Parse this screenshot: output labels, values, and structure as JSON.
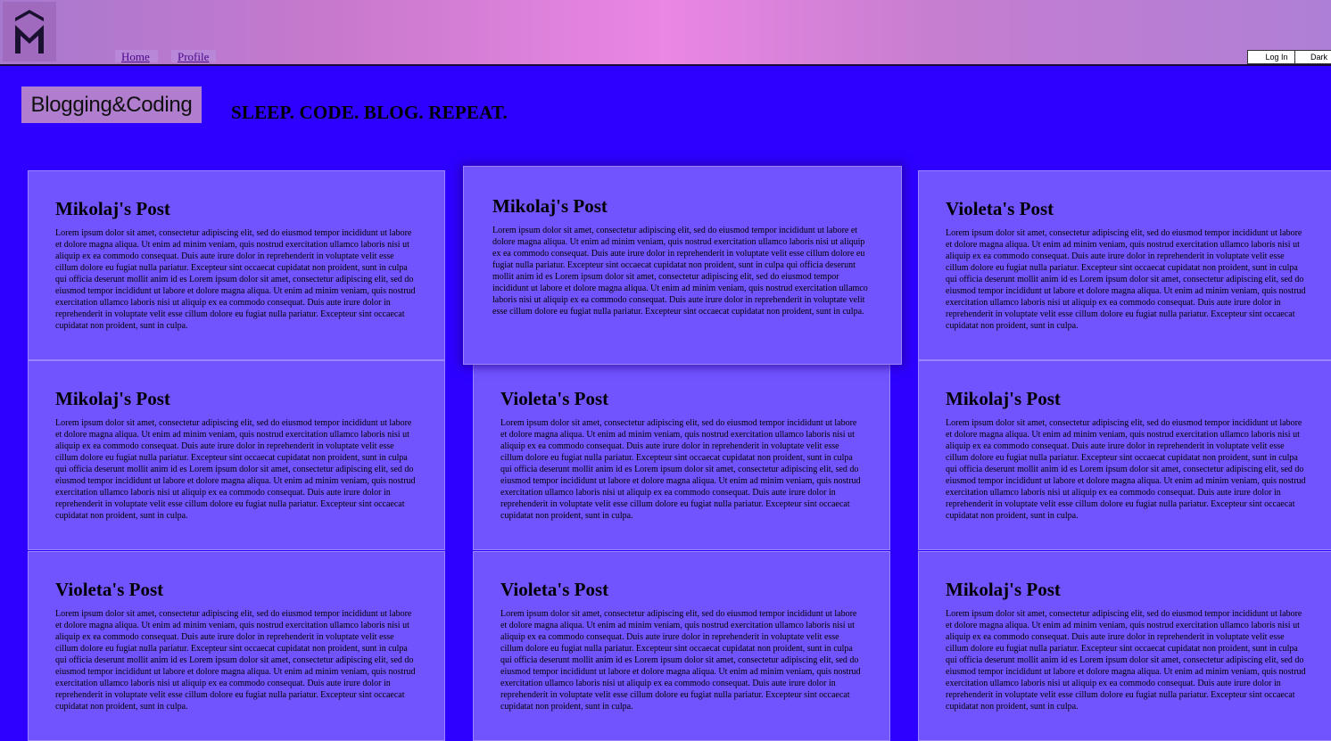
{
  "header": {
    "logo_icon": "M-hexagon-logo-icon",
    "nav": [
      {
        "label": "Home"
      },
      {
        "label": "Profile"
      }
    ],
    "login_label": "Log In",
    "dark_label": "Dark"
  },
  "hero": {
    "brand": "Blogging&Coding",
    "tagline": "SLEEP. CODE. BLOG. REPEAT."
  },
  "posts": [
    {
      "title": "Mikolaj's Post",
      "body": "Lorem ipsum dolor sit amet, consectetur adipiscing elit, sed do eiusmod tempor incididunt ut labore et dolore magna aliqua. Ut enim ad minim veniam, quis nostrud exercitation ullamco laboris nisi ut aliquip ex ea commodo consequat. Duis aute irure dolor in reprehenderit in voluptate velit esse cillum dolore eu fugiat nulla pariatur. Excepteur sint occaecat cupidatat non proident, sunt in culpa qui officia deserunt mollit anim id es Lorem ipsum dolor sit amet, consectetur adipiscing elit, sed do eiusmod tempor incididunt ut labore et dolore magna aliqua. Ut enim ad minim veniam, quis nostrud exercitation ullamco laboris nisi ut aliquip ex ea commodo consequat. Duis aute irure dolor in reprehenderit in voluptate velit esse cillum dolore eu fugiat nulla pariatur. Excepteur sint occaecat cupidatat non proident, sunt in culpa."
    },
    {
      "title": "Mikolaj's Post",
      "body": "Lorem ipsum dolor sit amet, consectetur adipiscing elit, sed do eiusmod tempor incididunt ut labore et dolore magna aliqua. Ut enim ad minim veniam, quis nostrud exercitation ullamco laboris nisi ut aliquip ex ea commodo consequat. Duis aute irure dolor in reprehenderit in voluptate velit esse cillum dolore eu fugiat nulla pariatur. Excepteur sint occaecat cupidatat non proident, sunt in culpa qui officia deserunt mollit anim id es Lorem ipsum dolor sit amet, consectetur adipiscing elit, sed do eiusmod tempor incididunt ut labore et dolore magna aliqua. Ut enim ad minim veniam, quis nostrud exercitation ullamco laboris nisi ut aliquip ex ea commodo consequat. Duis aute irure dolor in reprehenderit in voluptate velit esse cillum dolore eu fugiat nulla pariatur. Excepteur sint occaecat cupidatat non proident, sunt in culpa."
    },
    {
      "title": "Violeta's Post",
      "body": "Lorem ipsum dolor sit amet, consectetur adipiscing elit, sed do eiusmod tempor incididunt ut labore et dolore magna aliqua. Ut enim ad minim veniam, quis nostrud exercitation ullamco laboris nisi ut aliquip ex ea commodo consequat. Duis aute irure dolor in reprehenderit in voluptate velit esse cillum dolore eu fugiat nulla pariatur. Excepteur sint occaecat cupidatat non proident, sunt in culpa qui officia deserunt mollit anim id es Lorem ipsum dolor sit amet, consectetur adipiscing elit, sed do eiusmod tempor incididunt ut labore et dolore magna aliqua. Ut enim ad minim veniam, quis nostrud exercitation ullamco laboris nisi ut aliquip ex ea commodo consequat. Duis aute irure dolor in reprehenderit in voluptate velit esse cillum dolore eu fugiat nulla pariatur. Excepteur sint occaecat cupidatat non proident, sunt in culpa."
    },
    {
      "title": "Mikolaj's Post",
      "body": "Lorem ipsum dolor sit amet, consectetur adipiscing elit, sed do eiusmod tempor incididunt ut labore et dolore magna aliqua. Ut enim ad minim veniam, quis nostrud exercitation ullamco laboris nisi ut aliquip ex ea commodo consequat. Duis aute irure dolor in reprehenderit in voluptate velit esse cillum dolore eu fugiat nulla pariatur. Excepteur sint occaecat cupidatat non proident, sunt in culpa qui officia deserunt mollit anim id es Lorem ipsum dolor sit amet, consectetur adipiscing elit, sed do eiusmod tempor incididunt ut labore et dolore magna aliqua. Ut enim ad minim veniam, quis nostrud exercitation ullamco laboris nisi ut aliquip ex ea commodo consequat. Duis aute irure dolor in reprehenderit in voluptate velit esse cillum dolore eu fugiat nulla pariatur. Excepteur sint occaecat cupidatat non proident, sunt in culpa."
    },
    {
      "title": "Violeta's Post",
      "body": "Lorem ipsum dolor sit amet, consectetur adipiscing elit, sed do eiusmod tempor incididunt ut labore et dolore magna aliqua. Ut enim ad minim veniam, quis nostrud exercitation ullamco laboris nisi ut aliquip ex ea commodo consequat. Duis aute irure dolor in reprehenderit in voluptate velit esse cillum dolore eu fugiat nulla pariatur. Excepteur sint occaecat cupidatat non proident, sunt in culpa qui officia deserunt mollit anim id es Lorem ipsum dolor sit amet, consectetur adipiscing elit, sed do eiusmod tempor incididunt ut labore et dolore magna aliqua. Ut enim ad minim veniam, quis nostrud exercitation ullamco laboris nisi ut aliquip ex ea commodo consequat. Duis aute irure dolor in reprehenderit in voluptate velit esse cillum dolore eu fugiat nulla pariatur. Excepteur sint occaecat cupidatat non proident, sunt in culpa."
    },
    {
      "title": "Mikolaj's Post",
      "body": "Lorem ipsum dolor sit amet, consectetur adipiscing elit, sed do eiusmod tempor incididunt ut labore et dolore magna aliqua. Ut enim ad minim veniam, quis nostrud exercitation ullamco laboris nisi ut aliquip ex ea commodo consequat. Duis aute irure dolor in reprehenderit in voluptate velit esse cillum dolore eu fugiat nulla pariatur. Excepteur sint occaecat cupidatat non proident, sunt in culpa qui officia deserunt mollit anim id es Lorem ipsum dolor sit amet, consectetur adipiscing elit, sed do eiusmod tempor incididunt ut labore et dolore magna aliqua. Ut enim ad minim veniam, quis nostrud exercitation ullamco laboris nisi ut aliquip ex ea commodo consequat. Duis aute irure dolor in reprehenderit in voluptate velit esse cillum dolore eu fugiat nulla pariatur. Excepteur sint occaecat cupidatat non proident, sunt in culpa."
    },
    {
      "title": "Violeta's Post",
      "body": "Lorem ipsum dolor sit amet, consectetur adipiscing elit, sed do eiusmod tempor incididunt ut labore et dolore magna aliqua. Ut enim ad minim veniam, quis nostrud exercitation ullamco laboris nisi ut aliquip ex ea commodo consequat. Duis aute irure dolor in reprehenderit in voluptate velit esse cillum dolore eu fugiat nulla pariatur. Excepteur sint occaecat cupidatat non proident, sunt in culpa qui officia deserunt mollit anim id es Lorem ipsum dolor sit amet, consectetur adipiscing elit, sed do eiusmod tempor incididunt ut labore et dolore magna aliqua. Ut enim ad minim veniam, quis nostrud exercitation ullamco laboris nisi ut aliquip ex ea commodo consequat. Duis aute irure dolor in reprehenderit in voluptate velit esse cillum dolore eu fugiat nulla pariatur. Excepteur sint occaecat cupidatat non proident, sunt in culpa."
    },
    {
      "title": "Violeta's Post",
      "body": "Lorem ipsum dolor sit amet, consectetur adipiscing elit, sed do eiusmod tempor incididunt ut labore et dolore magna aliqua. Ut enim ad minim veniam, quis nostrud exercitation ullamco laboris nisi ut aliquip ex ea commodo consequat. Duis aute irure dolor in reprehenderit in voluptate velit esse cillum dolore eu fugiat nulla pariatur. Excepteur sint occaecat cupidatat non proident, sunt in culpa qui officia deserunt mollit anim id es Lorem ipsum dolor sit amet, consectetur adipiscing elit, sed do eiusmod tempor incididunt ut labore et dolore magna aliqua. Ut enim ad minim veniam, quis nostrud exercitation ullamco laboris nisi ut aliquip ex ea commodo consequat. Duis aute irure dolor in reprehenderit in voluptate velit esse cillum dolore eu fugiat nulla pariatur. Excepteur sint occaecat cupidatat non proident, sunt in culpa."
    },
    {
      "title": "Mikolaj's Post",
      "body": "Lorem ipsum dolor sit amet, consectetur adipiscing elit, sed do eiusmod tempor incididunt ut labore et dolore magna aliqua. Ut enim ad minim veniam, quis nostrud exercitation ullamco laboris nisi ut aliquip ex ea commodo consequat. Duis aute irure dolor in reprehenderit in voluptate velit esse cillum dolore eu fugiat nulla pariatur. Excepteur sint occaecat cupidatat non proident, sunt in culpa qui officia deserunt mollit anim id es Lorem ipsum dolor sit amet, consectetur adipiscing elit, sed do eiusmod tempor incididunt ut labore et dolore magna aliqua. Ut enim ad minim veniam, quis nostrud exercitation ullamco laboris nisi ut aliquip ex ea commodo consequat. Duis aute irure dolor in reprehenderit in voluptate velit esse cillum dolore eu fugiat nulla pariatur. Excepteur sint occaecat cupidatat non proident, sunt in culpa."
    }
  ]
}
